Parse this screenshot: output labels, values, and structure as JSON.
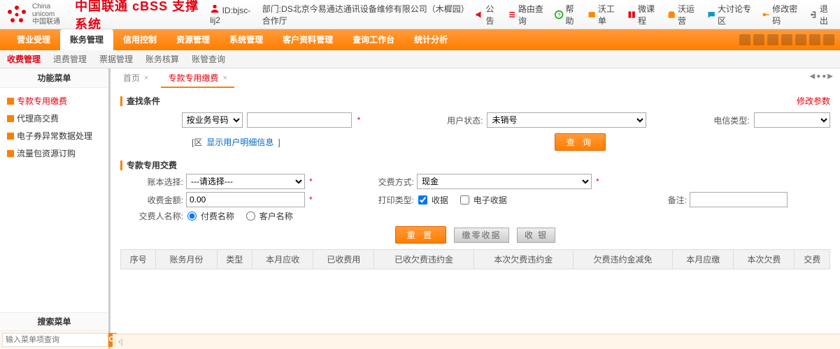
{
  "header": {
    "brand_en": "China unicom",
    "brand_cn": "中国联通",
    "app_title": "中国联通 cBSS 支撑系统",
    "id_label": "ID:",
    "id_value": "bjsc-lij2",
    "dept_label": "部门:",
    "dept_value": "DS北京今易通达通讯设备维修有限公司（木樨园）合作厅",
    "links": {
      "announce": "公告",
      "route": "路由查询",
      "help": "帮助",
      "wogd": "沃工单",
      "microclass": "微课程",
      "woyy": "沃运营",
      "forum": "大讨论专区",
      "pwd": "修改密码",
      "logout": "退出"
    }
  },
  "main_nav": [
    "营业受理",
    "账务管理",
    "信用控制",
    "资源管理",
    "系统管理",
    "客户资料管理",
    "查询工作台",
    "统计分析"
  ],
  "main_nav_active": 1,
  "sub_nav": [
    "收费管理",
    "退费管理",
    "票据管理",
    "账务核算",
    "账管查询"
  ],
  "sub_nav_active": 0,
  "sidebar": {
    "title": "功能菜单",
    "items": [
      "专款专用缴费",
      "代理商交费",
      "电子券异常数据处理",
      "流量包资源订购"
    ],
    "active": 0,
    "search_title": "搜索菜单",
    "search_placeholder": "输入菜单项查询"
  },
  "tabs": {
    "items": [
      {
        "label": "首页",
        "closable": true,
        "active": false
      },
      {
        "label": "专款专用缴费",
        "closable": true,
        "active": true
      }
    ],
    "nav_glyph": "◀●●▶"
  },
  "section1": {
    "title": "查找条件",
    "modify_params": "修改参数",
    "search_type_options": [
      "按业务号码"
    ],
    "user_status_label": "用户状态:",
    "user_status_options": [
      "未销号"
    ],
    "telecom_type_label": "电信类型:",
    "detail_link": "显示用户明细信息",
    "detail_prefix": "[区",
    "detail_suffix": "]",
    "query_btn": "查 询"
  },
  "section2": {
    "title": "专款专用交费",
    "acct_sel_label": "账本选择:",
    "acct_sel_placeholder": "---请选择---",
    "pay_method_label": "交费方式:",
    "pay_method_options": [
      "现金"
    ],
    "amount_label": "收费金额:",
    "amount_value": "0.00",
    "print_type_label": "打印类型:",
    "print_opt1": "收据",
    "print_opt2": "电子收据",
    "remark_label": "备注:",
    "payer_name_label": "交费人名称:",
    "payer_opt1": "付费名称",
    "payer_opt2": "客户名称"
  },
  "buttons": {
    "reset": "重 置",
    "reverse": "缴零收据",
    "charge": "收 银"
  },
  "table_headers": [
    "序号",
    "账务月份",
    "类型",
    "本月应收",
    "已收费用",
    "已收欠费违约金",
    "本次欠费违约金",
    "欠费违约金减免",
    "本月应缴",
    "本次欠费",
    "交费"
  ],
  "footer_glyph": "‹|"
}
